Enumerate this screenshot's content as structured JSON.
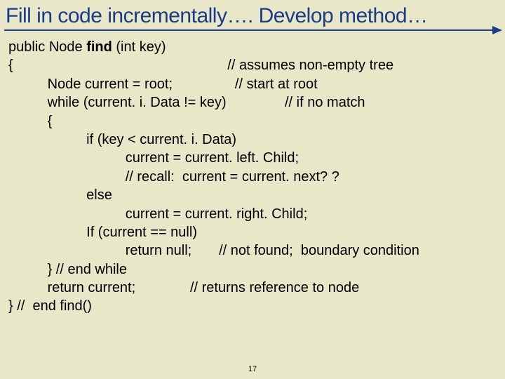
{
  "title": "Fill in code incrementally…. Develop method…",
  "lines": {
    "l1a": "public Node ",
    "l1b": "find",
    "l1c": " (int key)",
    "l2": "{                                                       // assumes non-empty tree",
    "l3": "          Node current = root;                // start at root",
    "l4": "",
    "l5": "          while (current. i. Data != key)               // if no match",
    "l6": "          {",
    "l7": "                    if (key < current. i. Data)",
    "l8": "                              current = current. left. Child;",
    "l9": "                              // recall:  current = current. next? ?",
    "l10": "                    else",
    "l11": "                              current = current. right. Child;",
    "l12": "                    If (current == null)",
    "l13": "                              return null;       // not found;  boundary condition",
    "l14": "          } // end while",
    "l15": "          return current;              // returns reference to node",
    "l16": "} //  end find()"
  },
  "pagenum": "17"
}
